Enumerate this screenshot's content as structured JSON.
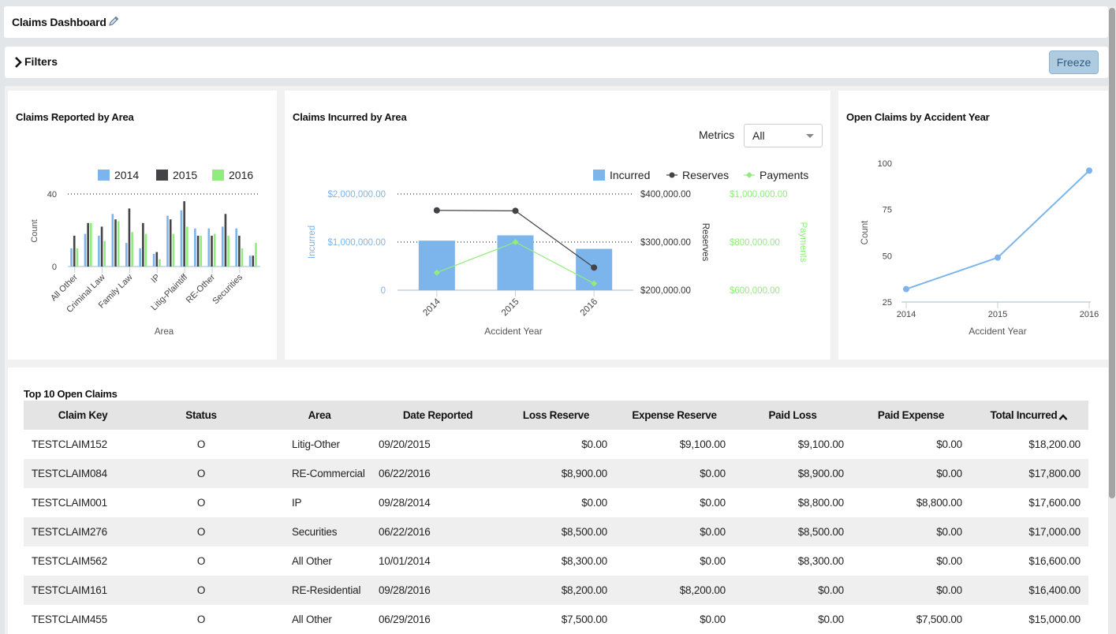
{
  "header": {
    "title": "Claims Dashboard",
    "edit_icon": "pencil-icon"
  },
  "filters": {
    "label": "Filters",
    "toggle_icon": "chevron-right-icon",
    "freeze_label": "Freeze"
  },
  "colors": {
    "series2014": "#7cb5ec",
    "series2015": "#434348",
    "series2016": "#90ed7d",
    "freeze_bg": "#aecbe0"
  },
  "chart_data": [
    {
      "type": "bar",
      "title": "Claims Reported by Area",
      "xlabel": "Area",
      "ylabel": "Count",
      "ylim": [
        0,
        40
      ],
      "yticks": [
        "0",
        "40"
      ],
      "legend": "top-right",
      "categories": [
        "All Other",
        "",
        "Criminal Law",
        "",
        "Family Law",
        "",
        "IP",
        "",
        "Litig-Plaintiff",
        "",
        "RE-Other",
        "",
        "Securities",
        ""
      ],
      "series": [
        {
          "name": "2014",
          "values": [
            10,
            18,
            17,
            29,
            13,
            10,
            7,
            28,
            31,
            21,
            21,
            22,
            21,
            6
          ]
        },
        {
          "name": "2015",
          "values": [
            17,
            24,
            22,
            26,
            32,
            24,
            8,
            26,
            36,
            17,
            17,
            29,
            17,
            6
          ]
        },
        {
          "name": "2016",
          "values": [
            10,
            24,
            14,
            25,
            19,
            18,
            4,
            18,
            22,
            17,
            18,
            17,
            10,
            13
          ]
        }
      ]
    },
    {
      "type": "bar",
      "title": "Claims Incurred by Area",
      "xlabel": "Accident Year",
      "categories": [
        "2014",
        "2015",
        "2016"
      ],
      "legend": "top-right",
      "axes": [
        {
          "label": "Incurred",
          "ticks": [
            "0",
            "$1,000,000.00",
            "$2,000,000.00"
          ],
          "range": [
            0,
            2000000
          ]
        },
        {
          "label": "Reserves",
          "ticks": [
            "$200,000.00",
            "$300,000.00",
            "$400,000.00"
          ],
          "range": [
            200000,
            400000
          ]
        },
        {
          "label": "Payments",
          "ticks": [
            "$600,000.00",
            "$800,000.00",
            "$1,000,000.00"
          ],
          "range": [
            600000,
            1000000
          ]
        }
      ],
      "series": [
        {
          "name": "Incurred",
          "kind": "bar",
          "values": [
            1030000,
            1140000,
            860000
          ]
        },
        {
          "name": "Reserves",
          "kind": "line",
          "values": [
            366000,
            365000,
            247000
          ]
        },
        {
          "name": "Payments",
          "kind": "line",
          "values": [
            673000,
            800000,
            628000
          ]
        }
      ]
    },
    {
      "type": "line",
      "title": "Open Claims by Accident Year",
      "xlabel": "Accident Year",
      "ylabel": "Count",
      "ylim": [
        25,
        100
      ],
      "yticks": [
        "25",
        "50",
        "75",
        "100"
      ],
      "categories": [
        "2014",
        "2015",
        "2016"
      ],
      "series": [
        {
          "name": "Count",
          "values": [
            32,
            49,
            96
          ]
        }
      ]
    }
  ],
  "metrics": {
    "label": "Metrics",
    "selected": "All"
  },
  "table": {
    "title": "Top 10 Open Claims",
    "columns": [
      "Claim Key",
      "Status",
      "Area",
      "Date Reported",
      "Loss Reserve",
      "Expense Reserve",
      "Paid Loss",
      "Paid Expense",
      "Total Incurred"
    ],
    "sort_column": "Total Incurred",
    "rows": [
      [
        "TESTCLAIM152",
        "O",
        "Litig-Other",
        "09/20/2015",
        "$0.00",
        "$9,100.00",
        "$9,100.00",
        "$0.00",
        "$18,200.00"
      ],
      [
        "TESTCLAIM084",
        "O",
        "RE-Commercial",
        "06/22/2016",
        "$8,900.00",
        "$0.00",
        "$8,900.00",
        "$0.00",
        "$17,800.00"
      ],
      [
        "TESTCLAIM001",
        "O",
        "IP",
        "09/28/2014",
        "$0.00",
        "$0.00",
        "$8,800.00",
        "$8,800.00",
        "$17,600.00"
      ],
      [
        "TESTCLAIM276",
        "O",
        "Securities",
        "06/22/2016",
        "$8,500.00",
        "$0.00",
        "$8,500.00",
        "$0.00",
        "$17,000.00"
      ],
      [
        "TESTCLAIM562",
        "O",
        "All Other",
        "10/01/2014",
        "$8,300.00",
        "$0.00",
        "$8,300.00",
        "$0.00",
        "$16,600.00"
      ],
      [
        "TESTCLAIM161",
        "O",
        "RE-Residential",
        "09/28/2016",
        "$8,200.00",
        "$8,200.00",
        "$0.00",
        "$0.00",
        "$16,400.00"
      ],
      [
        "TESTCLAIM455",
        "O",
        "All Other",
        "06/29/2016",
        "$7,500.00",
        "$0.00",
        "$0.00",
        "$7,500.00",
        "$15,000.00"
      ]
    ]
  }
}
